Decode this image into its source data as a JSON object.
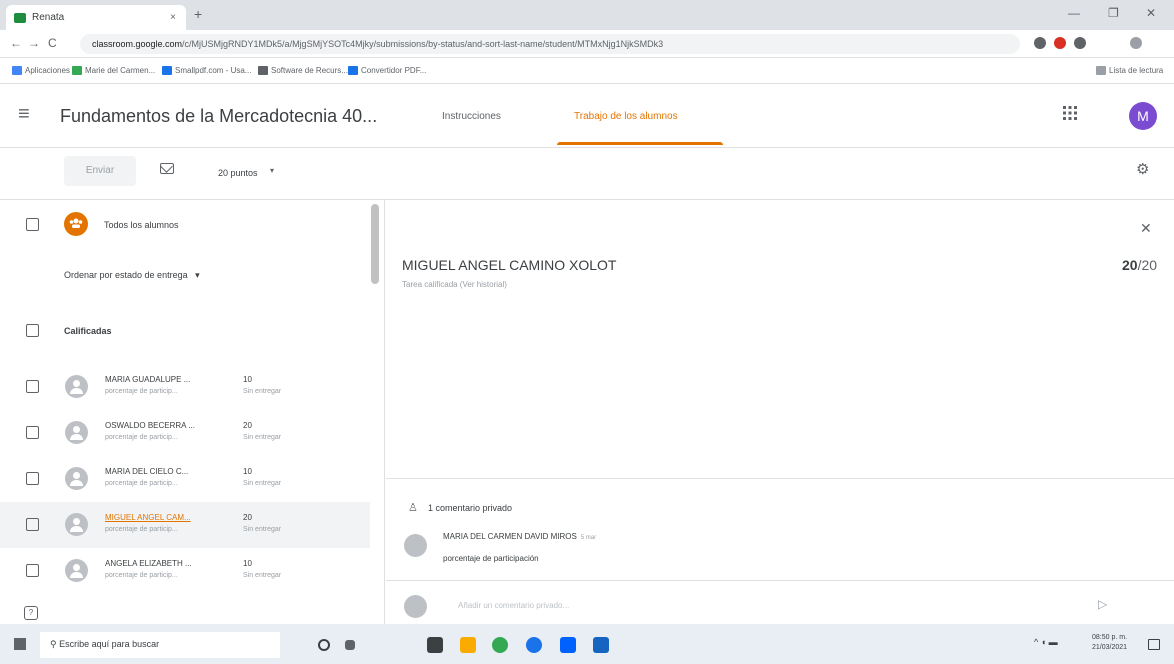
{
  "browser": {
    "tab_title": "Renata",
    "tab_close": "×",
    "new_tab": "+",
    "url_host": "classroom.google.com",
    "url_path": "/c/MjUSMjgRNDY1MDk5/a/MjgSMjYSOTc4Mjky/submissions/by-status/and-sort-last-name/student/MTMxNjg1NjkSMDk3",
    "window_controls": [
      "—",
      "❐",
      "✕"
    ],
    "nav": [
      "←",
      "→",
      "C"
    ],
    "bookmarks": [
      {
        "label": "Aplicaciones",
        "color": "#4285f4"
      },
      {
        "label": "Marie del Carmen...",
        "color": "#34a853"
      },
      {
        "label": "Smallpdf.com - Usa...",
        "color": "#1a73e8"
      },
      {
        "label": "Software de Recurs...",
        "color": "#5f6368"
      },
      {
        "label": "Convertidor PDF...",
        "color": "#1a73e8"
      }
    ],
    "reading_list": "Lista de lectura"
  },
  "header": {
    "class_title": "Fundamentos de la Mercadotecnia 40...",
    "tabs": [
      {
        "label": "Instrucciones",
        "active": false
      },
      {
        "label": "Trabajo de los alumnos",
        "active": true
      }
    ],
    "avatar_letter": "M"
  },
  "toolbar": {
    "send_label": "Enviar",
    "points_label": "20 puntos",
    "points_dropdown": "▾"
  },
  "left": {
    "all_students": "Todos los alumnos",
    "sort_label": "Ordenar por estado de entrega",
    "sort_dropdown": "▾",
    "section": "Calificadas",
    "students": [
      {
        "name": "MARIA GUADALUPE ...",
        "note": "porcentaje de particip...",
        "grade": "10",
        "status": "Sin entregar",
        "selected": false
      },
      {
        "name": "OSWALDO BECERRA ...",
        "note": "porcentaje de particip...",
        "grade": "20",
        "status": "Sin entregar",
        "selected": false
      },
      {
        "name": "MARIA DEL CIELO C...",
        "note": "porcentaje de particip...",
        "grade": "10",
        "status": "Sin entregar",
        "selected": false
      },
      {
        "name": "MIGUEL ANGEL CAM...",
        "note": "porcentaje de particip...",
        "grade": "20",
        "status": "Sin entregar",
        "selected": true
      },
      {
        "name": "ANGELA ELIZABETH ...",
        "note": "porcentaje de particip...",
        "grade": "10",
        "status": "Sin entregar",
        "selected": false
      }
    ]
  },
  "right": {
    "student_name": "MIGUEL ANGEL CAMINO XOLOT",
    "status": "Tarea calificada (Ver historial)",
    "grade_value": "20",
    "grade_total": "/20",
    "close": "✕",
    "comment_count": "1 comentario privado",
    "comment_author": "MARIA DEL CARMEN DAVID MIROS",
    "comment_time": "5 mar",
    "comment_text": "porcentaje de participación",
    "comment_placeholder": "Añadir un comentario privado...",
    "send_icon": "▷"
  },
  "taskbar": {
    "search_placeholder": "Escribe aquí para buscar",
    "time": "08:50 p. m.",
    "date": "21/03/2021"
  },
  "icons": {
    "menu": "≡",
    "apps": "⋮⋮⋮",
    "settings": "⚙",
    "person": "♙",
    "help": "?"
  },
  "colors": {
    "accent": "#e37400",
    "avatar": "#7b4bd1"
  }
}
